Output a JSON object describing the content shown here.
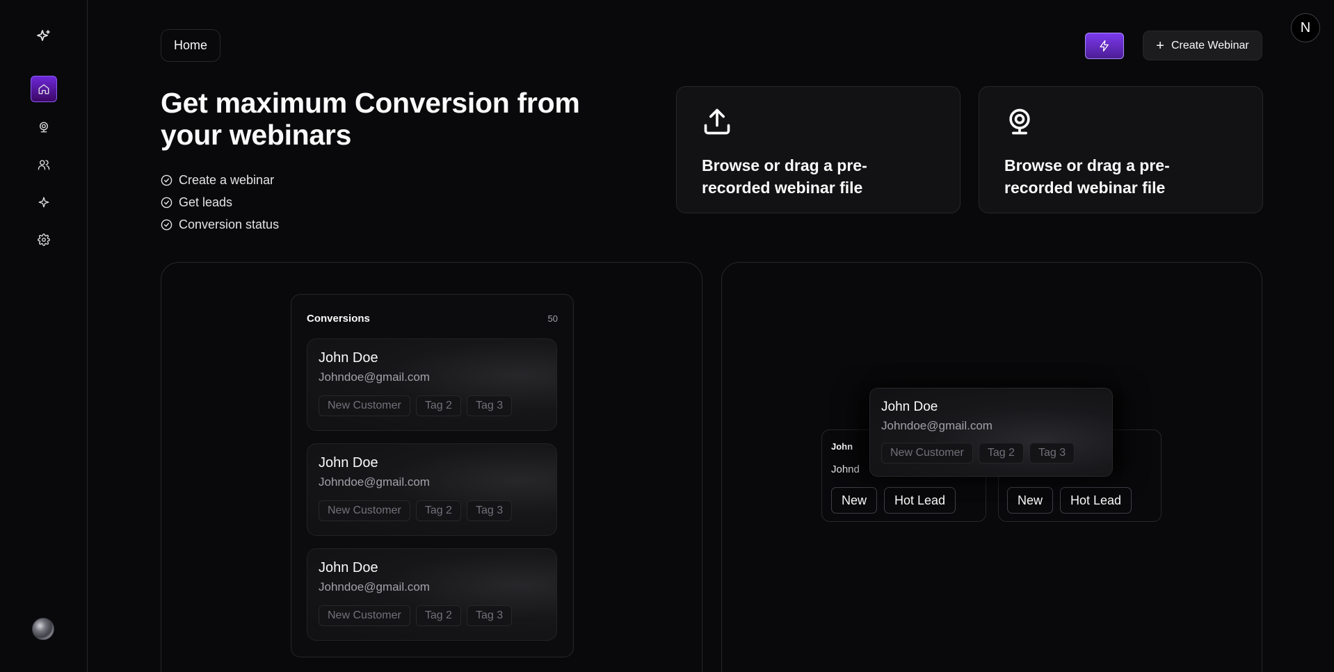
{
  "sidebar": {
    "items": [
      {
        "icon": "sparkles-icon"
      },
      {
        "icon": "home-icon",
        "active": true
      },
      {
        "icon": "webcam-icon"
      },
      {
        "icon": "users-icon"
      },
      {
        "icon": "sparkle-icon"
      },
      {
        "icon": "gear-icon"
      }
    ]
  },
  "header": {
    "breadcrumb": "Home",
    "create_label": "Create Webinar",
    "account_initial": "N"
  },
  "hero": {
    "title": "Get maximum Conversion from your webinars",
    "features": [
      "Create a webinar",
      "Get leads",
      "Conversion status"
    ]
  },
  "upload_cards": [
    {
      "icon": "upload-icon",
      "text": "Browse or drag a pre-recorded webinar file"
    },
    {
      "icon": "webcam-icon",
      "text": "Browse or drag a pre-recorded webinar file"
    }
  ],
  "conversions": {
    "title": "Conversions",
    "count": "50",
    "leads": [
      {
        "name": "John Doe",
        "email": "Johndoe@gmail.com",
        "tags": [
          "New Customer",
          "Tag 2",
          "Tag 3"
        ]
      },
      {
        "name": "John Doe",
        "email": "Johndoe@gmail.com",
        "tags": [
          "New Customer",
          "Tag 2",
          "Tag 3"
        ]
      },
      {
        "name": "John Doe",
        "email": "Johndoe@gmail.com",
        "tags": [
          "New Customer",
          "Tag 2",
          "Tag 3"
        ]
      }
    ]
  },
  "pipeline": {
    "back_cards": [
      {
        "name": "John",
        "email": "Johnd",
        "tags": [
          "New",
          "Hot Lead"
        ]
      },
      {
        "tags": [
          "New",
          "Hot Lead"
        ]
      }
    ],
    "front_card": {
      "name": "John Doe",
      "email": "Johndoe@gmail.com",
      "tags": [
        "New Customer",
        "Tag 2",
        "Tag 3"
      ]
    }
  },
  "colors": {
    "background": "#09090b",
    "accent": "#7c3aed",
    "border": "#27272a",
    "muted_text": "#a1a1aa"
  }
}
